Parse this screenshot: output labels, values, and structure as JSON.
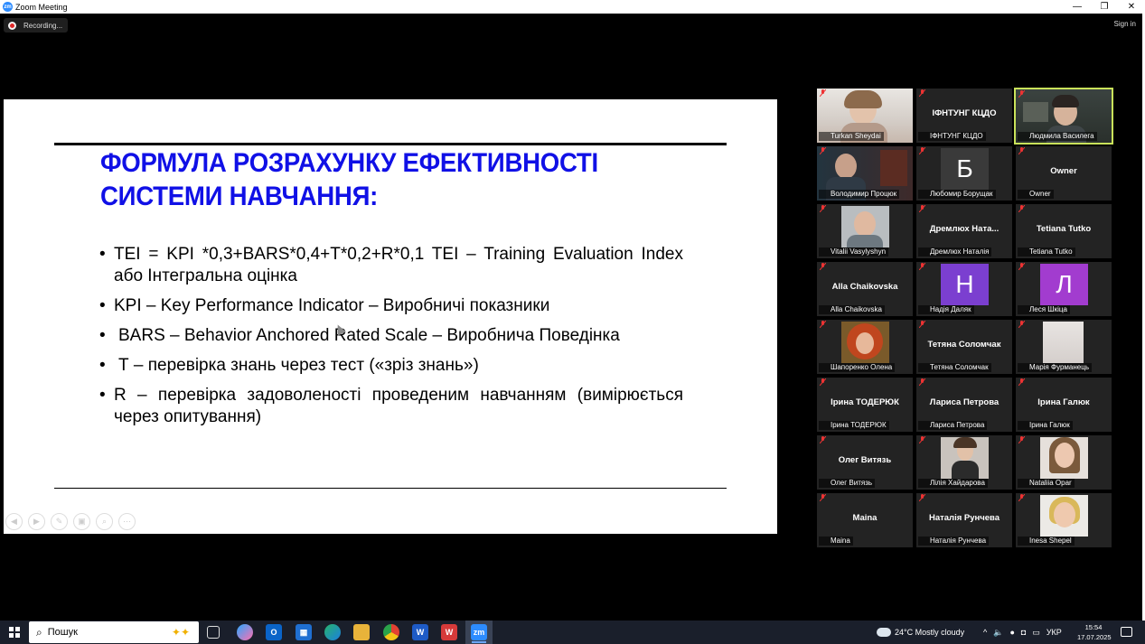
{
  "window": {
    "title": "Zoom Meeting",
    "controls": [
      "—",
      "❐",
      "✕"
    ]
  },
  "meeting": {
    "recording_label": "Recording...",
    "signin_label": "Sign in"
  },
  "slide": {
    "heading_line1": "ФОРМУЛА РОЗРАХУНКУ ЕФЕКТИВНОСТІ",
    "heading_line2": "СИСТЕМИ НАВЧАННЯ:",
    "bullets": [
      "TEI = KPI *0,3+BARS*0,4+T*0,2+R*0,1 TEI – Training Evaluation Index або Інтегральна оцінка",
      "KPI – Key Performance Indicator – Виробничі показники",
      "BARS – Behavior Anchored Rated Scale – Виробнича Поведінка",
      "Т – перевірка знань через тест («зріз знань»)",
      "R – перевірка задоволеності проведеним навчанням (вимірюється через опитування)"
    ]
  },
  "participants": [
    {
      "label": "Turkan Sheydai",
      "name": "",
      "avatar": "",
      "type": "photo"
    },
    {
      "label": "ІФНТУНГ КЦДО",
      "name": "ІФНТУНГ КЦДО",
      "avatar": "",
      "type": "name"
    },
    {
      "label": "Людмила Василега",
      "name": "",
      "avatar": "",
      "type": "photo",
      "active": true
    },
    {
      "label": "Володимир Процюк",
      "name": "",
      "avatar": "",
      "type": "photo"
    },
    {
      "label": "Любомир Борущак",
      "name": "",
      "avatar": "Б",
      "type": "letter",
      "color": "#3a3a3a"
    },
    {
      "label": "Owner",
      "name": "Owner",
      "avatar": "",
      "type": "name"
    },
    {
      "label": "Vitalii Vasylyshyn",
      "name": "",
      "avatar": "",
      "type": "photo"
    },
    {
      "label": "Дремлюх Наталія",
      "name": "Дремлюх  Ната...",
      "avatar": "",
      "type": "name"
    },
    {
      "label": "Tetiana Tutko",
      "name": "Tetiana Tutko",
      "avatar": "",
      "type": "name"
    },
    {
      "label": "Alla Chaikovska",
      "name": "Alla Chaikovska",
      "avatar": "",
      "type": "name"
    },
    {
      "label": "Надія Даляк",
      "name": "",
      "avatar": "Н",
      "type": "letter",
      "color": "#7b3fd0"
    },
    {
      "label": "Леся Шкіца",
      "name": "",
      "avatar": "Л",
      "type": "letter",
      "color": "#a23ccf"
    },
    {
      "label": "Шапоренко Олена",
      "name": "",
      "avatar": "",
      "type": "photo"
    },
    {
      "label": "Тетяна Соломчак",
      "name": "Тетяна Соломчак",
      "avatar": "",
      "type": "name"
    },
    {
      "label": "Марія Фурманець",
      "name": "",
      "avatar": "",
      "type": "photo"
    },
    {
      "label": "Ірина ТОДЕРЮК",
      "name": "Ірина ТОДЕРЮК",
      "avatar": "",
      "type": "name"
    },
    {
      "label": "Лариса Петрова",
      "name": "Лариса Петрова",
      "avatar": "",
      "type": "name"
    },
    {
      "label": "Ірина Галюк",
      "name": "Ірина Галюк",
      "avatar": "",
      "type": "name"
    },
    {
      "label": "Олег Витязь",
      "name": "Олег Витязь",
      "avatar": "",
      "type": "name"
    },
    {
      "label": "Лілія Хайдарова",
      "name": "",
      "avatar": "",
      "type": "photo"
    },
    {
      "label": "Nataliia Opar",
      "name": "",
      "avatar": "",
      "type": "photo"
    },
    {
      "label": "Maina",
      "name": "Maina",
      "avatar": "",
      "type": "name"
    },
    {
      "label": "Наталія Рунчева",
      "name": "Наталія Рунчева",
      "avatar": "",
      "type": "name"
    },
    {
      "label": "Inesa Shepel",
      "name": "",
      "avatar": "",
      "type": "photo"
    }
  ],
  "taskbar": {
    "search_placeholder": "Пошук",
    "weather": "24°C  Mostly cloudy",
    "language": "УКР",
    "time": "15:54",
    "date": "17.07.2025"
  },
  "colors": {
    "heading_blue": "#1010e6",
    "active_speaker": "#c9e25a",
    "tile_bg": "#232323"
  }
}
